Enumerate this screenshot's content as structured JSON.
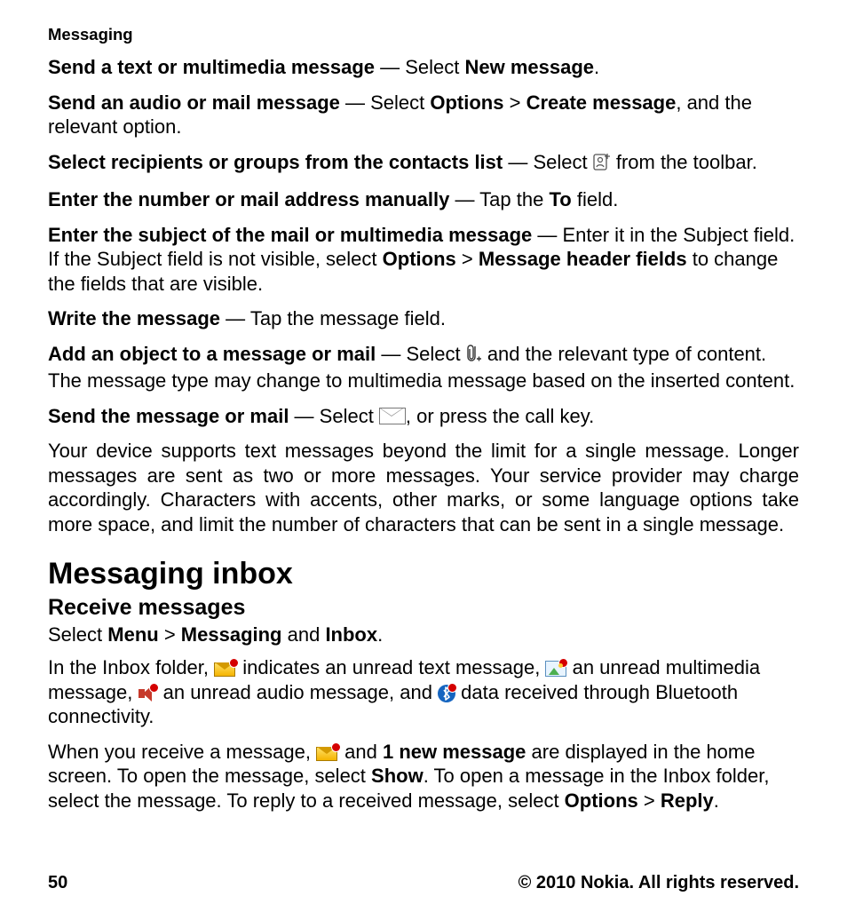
{
  "runningHead": "Messaging",
  "p1": {
    "lead": "Send a text or multimedia message",
    "dash": " —  Select ",
    "bold1": "New message",
    "tail": "."
  },
  "p2": {
    "lead": "Send an audio or mail message",
    "a": " —  Select ",
    "bold1": "Options",
    "gt": "  >  ",
    "bold2": "Create message",
    "tail": ", and the relevant option."
  },
  "p3": {
    "lead": "Select recipients or groups from the contacts list",
    "a": " —  Select ",
    "tail": " from the toolbar."
  },
  "p4": {
    "lead": "Enter the number or mail address manually",
    "a": " —  Tap the ",
    "bold1": "To",
    "tail": " field."
  },
  "p5": {
    "lead": "Enter the subject of the mail or multimedia message",
    "a": " —  Enter it in the Subject field. If the Subject field is not visible, select ",
    "bold1": "Options",
    "gt": "  >  ",
    "bold2": "Message header fields",
    "tail": " to change the fields that are visible."
  },
  "p6": {
    "lead": "Write the message",
    "a": " —  Tap the message field."
  },
  "p7": {
    "lead": "Add an object to a message or mail",
    "a": " —  Select ",
    "b": " and the relevant type of content. The message type may change to multimedia message based on the inserted content."
  },
  "p8": {
    "lead": "Send the message or mail",
    "a": " —  Select ",
    "b": ", or press the call key."
  },
  "p9": "Your device supports text messages beyond the limit for a single message. Longer messages are sent as two or more messages. Your service provider may charge accordingly. Characters with accents, other marks, or some language options take more space, and limit the number of characters that can be sent in a single message.",
  "h1": "Messaging inbox",
  "h2": "Receive messages",
  "p10": {
    "a": "Select ",
    "bold1": "Menu",
    "gt1": "  >  ",
    "bold2": "Messaging",
    "mid": " and ",
    "bold3": "Inbox",
    "dot": "."
  },
  "p11": {
    "a": "In the Inbox folder, ",
    "b": " indicates an unread text message, ",
    "c": " an unread multimedia message, ",
    "d": " an unread audio message, and ",
    "e": " data received through Bluetooth connectivity."
  },
  "p12": {
    "a": "When you receive a message, ",
    "b": " and ",
    "bold1": "1 new message",
    "c": " are displayed in the home screen. To open the message, select ",
    "bold2": "Show",
    "d": ". To open a message in the Inbox folder, select the message. To reply to a received message, select ",
    "bold3": "Options",
    "gt": "  >  ",
    "bold4": "Reply",
    "dot": "."
  },
  "footer": {
    "page": "50",
    "copyright": "© 2010 Nokia. All rights reserved."
  }
}
